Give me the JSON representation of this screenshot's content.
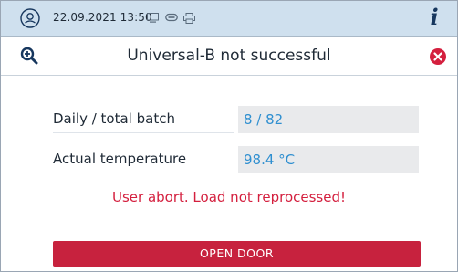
{
  "status": {
    "datetime": "22.09.2021 13:50",
    "icons": [
      "display-icon",
      "link-icon",
      "printer-icon"
    ],
    "info_icon_glyph": "i"
  },
  "header": {
    "title": "Universal-B not successful",
    "zoom_icon": "zoom-in-icon",
    "close_icon": "error-close-icon"
  },
  "rows": [
    {
      "label": "Daily / total batch",
      "value": "8 / 82"
    },
    {
      "label": "Actual temperature",
      "value": "98.4 °C"
    }
  ],
  "message": "User abort. Load not reprocessed!",
  "action": {
    "label": "OPEN DOOR"
  },
  "colors": {
    "statusbar": "#cfe0ee",
    "accent_blue": "#2f8fd0",
    "error_red": "#d41f3e",
    "button_red": "#c7223e",
    "field_gray": "#e9eaec"
  }
}
